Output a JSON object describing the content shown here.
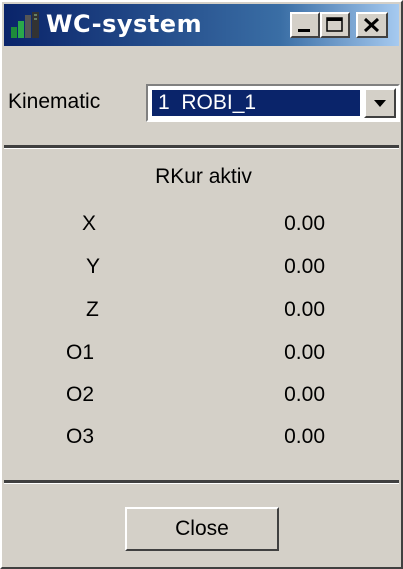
{
  "window": {
    "title": "WC-system",
    "icon": "app-icon"
  },
  "titlebar_buttons": {
    "minimize": "minimize-icon",
    "maximize": "maximize-icon",
    "close": "close-icon"
  },
  "kinematic": {
    "label": "Kinematic",
    "selected": "1  ROBI_1"
  },
  "coords": {
    "heading": "RKur aktiv",
    "rows": [
      {
        "label": "X",
        "value": "0.00"
      },
      {
        "label": "Y",
        "value": "0.00"
      },
      {
        "label": "Z",
        "value": "0.00"
      },
      {
        "label": "O1",
        "value": "0.00"
      },
      {
        "label": "O2",
        "value": "0.00"
      },
      {
        "label": "O3",
        "value": "0.00"
      }
    ]
  },
  "footer": {
    "close_label": "Close"
  }
}
